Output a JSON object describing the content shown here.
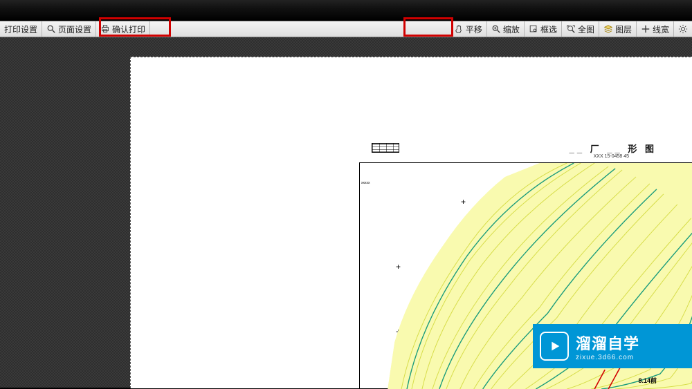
{
  "toolbar": {
    "left": [
      {
        "name": "print-settings",
        "label": "打印设置",
        "icon": ""
      },
      {
        "name": "page-setup",
        "label": "页面设置",
        "icon": "magnify"
      },
      {
        "name": "confirm-print",
        "label": "确认打印",
        "icon": "printer"
      }
    ],
    "right": [
      {
        "name": "pan",
        "label": "平移",
        "icon": "hand"
      },
      {
        "name": "zoom",
        "label": "缩放",
        "icon": "magnify"
      },
      {
        "name": "box-select",
        "label": "框选",
        "icon": "box"
      },
      {
        "name": "full-view",
        "label": "全图",
        "icon": "full"
      },
      {
        "name": "layers",
        "label": "图层",
        "icon": "layers"
      },
      {
        "name": "line-width",
        "label": "线宽",
        "icon": "plus"
      },
      {
        "name": "extra",
        "label": "",
        "icon": "gear"
      }
    ]
  },
  "map": {
    "title": "__ 厂 __ 形 图",
    "subtitle": "XXX 15-0458 45",
    "corner_label": "xxxxx",
    "dimension_label": "8.14前"
  },
  "watermark": {
    "cn": "溜溜自学",
    "en": "zixue.3d66.com"
  },
  "colors": {
    "highlight": "#d10000",
    "brand": "#0096d6",
    "contour_fill": "#f6f7a8",
    "contour_major": "#1a9c7c",
    "contour_minor": "#d7dd4a"
  }
}
